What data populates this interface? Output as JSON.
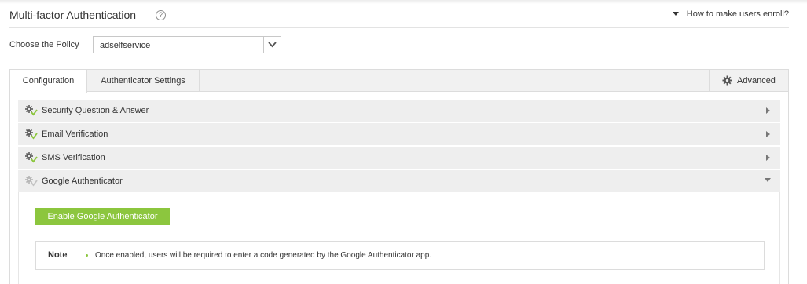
{
  "header": {
    "title": "Multi-factor Authentication",
    "help_icon": "?",
    "enroll_link": "How to make users enroll?"
  },
  "policy": {
    "label": "Choose the Policy",
    "selected": "adselfservice"
  },
  "tabs": [
    {
      "label": "Configuration",
      "active": true
    },
    {
      "label": "Authenticator Settings",
      "active": false
    }
  ],
  "advanced": {
    "label": "Advanced",
    "icon": "gear-icon"
  },
  "accordion": [
    {
      "label": "Security Question & Answer",
      "expanded": false,
      "enabled": true
    },
    {
      "label": "Email Verification",
      "expanded": false,
      "enabled": true
    },
    {
      "label": "SMS Verification",
      "expanded": false,
      "enabled": true
    },
    {
      "label": "Google Authenticator",
      "expanded": true,
      "enabled": false
    }
  ],
  "google": {
    "enable_button": "Enable Google Authenticator",
    "note_title": "Note",
    "note_text": "Once enabled, users will be required to enter a code generated by the Google Authenticator app."
  },
  "colors": {
    "accent_green": "#8cc63e",
    "row_bg": "#eeeeee",
    "tabbar_bg": "#f1f1f1"
  }
}
